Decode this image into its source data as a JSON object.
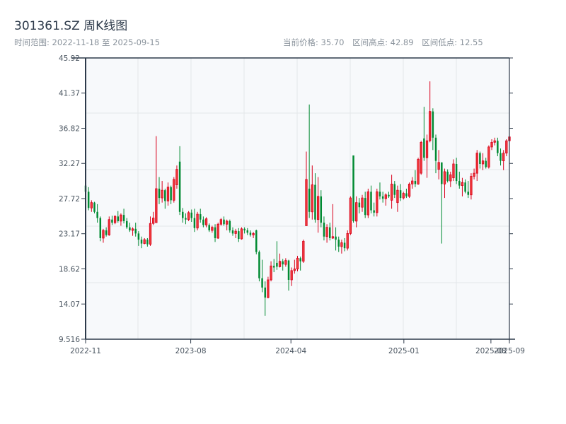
{
  "header": {
    "title": "301361.SZ 周K线图",
    "range_label": "时间范围: 2022-11-18 至 2025-09-15",
    "current_price_label": "当前价格: 35.70",
    "high_label": "区间高点: 42.89",
    "low_label": "区间低点: 12.55"
  },
  "colors": {
    "up": "#d9001b",
    "up_fill": "#f03c3c",
    "down": "#008a32",
    "axis": "#2d3a4a",
    "plot_bg": "#f7f9fb",
    "grid": "#e3e6ea"
  },
  "chart_data": {
    "type": "candlestick",
    "title": "301361.SZ 周K线图",
    "start_date": "2022-11-18",
    "end_date": "2025-09-15",
    "ylim": [
      9.516,
      45.92
    ],
    "y_ticks": [
      "45.92",
      "41.37",
      "36.82",
      "32.27",
      "27.72",
      "23.17",
      "18.62",
      "14.07",
      "9.516"
    ],
    "x_ticks": [
      {
        "label": "2022-11",
        "date": "2022-11-18"
      },
      {
        "label": "2023-08",
        "date": "2023-08-01"
      },
      {
        "label": "2024-04",
        "date": "2024-04-01"
      },
      {
        "label": "2025-01",
        "date": "2025-01-01"
      },
      {
        "label": "2025-08",
        "date": "2025-08-01"
      },
      {
        "label": "2025-09",
        "date": "2025-09-15"
      }
    ],
    "grid": true,
    "ohlc": [
      [
        29.4,
        29.8,
        28.5,
        28.6
      ],
      [
        28.6,
        29.2,
        26.2,
        26.5
      ],
      [
        26.5,
        27.5,
        26.0,
        27.2
      ],
      [
        27.2,
        27.3,
        25.8,
        26.0
      ],
      [
        26.0,
        27.0,
        24.6,
        25.2
      ],
      [
        25.2,
        25.4,
        22.2,
        22.6
      ],
      [
        22.6,
        23.8,
        22.0,
        23.6
      ],
      [
        23.6,
        24.0,
        22.8,
        23.0
      ],
      [
        23.0,
        25.4,
        22.9,
        25.0
      ],
      [
        25.0,
        25.5,
        24.3,
        24.6
      ],
      [
        24.6,
        25.6,
        24.4,
        25.4
      ],
      [
        25.4,
        26.1,
        24.6,
        24.8
      ],
      [
        24.8,
        25.8,
        24.2,
        25.6
      ],
      [
        25.6,
        26.4,
        24.5,
        24.8
      ],
      [
        24.8,
        25.2,
        23.8,
        24.0
      ],
      [
        24.0,
        24.6,
        23.4,
        23.6
      ],
      [
        23.6,
        24.0,
        22.9,
        23.8
      ],
      [
        23.8,
        24.6,
        22.8,
        23.2
      ],
      [
        23.2,
        23.5,
        21.6,
        22.4
      ],
      [
        22.4,
        22.8,
        21.3,
        21.9
      ],
      [
        21.9,
        22.6,
        21.8,
        22.4
      ],
      [
        22.4,
        22.6,
        21.5,
        21.8
      ],
      [
        21.8,
        25.4,
        21.6,
        24.5
      ],
      [
        24.5,
        26.0,
        24.3,
        25.2
      ],
      [
        24.6,
        35.8,
        24.6,
        29.0
      ],
      [
        29.0,
        30.5,
        27.0,
        27.8
      ],
      [
        27.8,
        30.0,
        27.2,
        28.8
      ],
      [
        28.8,
        29.0,
        26.4,
        27.4
      ],
      [
        27.4,
        29.8,
        26.8,
        29.2
      ],
      [
        29.2,
        29.4,
        27.0,
        27.5
      ],
      [
        27.5,
        30.5,
        27.2,
        30.2
      ],
      [
        29.5,
        32.0,
        29.0,
        31.5
      ],
      [
        32.5,
        34.5,
        25.6,
        26.0
      ],
      [
        26.0,
        26.5,
        24.6,
        25.2
      ],
      [
        25.2,
        25.8,
        24.4,
        25.0
      ],
      [
        25.0,
        26.1,
        24.8,
        25.9
      ],
      [
        25.9,
        26.3,
        24.7,
        25.2
      ],
      [
        25.2,
        26.4,
        23.4,
        23.9
      ],
      [
        23.9,
        26.0,
        23.6,
        25.7
      ],
      [
        25.7,
        26.4,
        24.6,
        25.0
      ],
      [
        25.0,
        25.4,
        24.0,
        24.3
      ],
      [
        24.3,
        25.3,
        24.0,
        25.1
      ],
      [
        24.3,
        24.5,
        23.4,
        23.6
      ],
      [
        23.6,
        24.2,
        23.3,
        24.0
      ],
      [
        24.0,
        24.4,
        22.1,
        22.6
      ],
      [
        22.6,
        24.6,
        22.5,
        24.4
      ],
      [
        24.4,
        25.2,
        24.2,
        25.0
      ],
      [
        25.0,
        25.4,
        24.2,
        24.4
      ],
      [
        24.4,
        25.0,
        23.6,
        24.8
      ],
      [
        24.8,
        25.0,
        23.3,
        23.6
      ],
      [
        23.6,
        24.0,
        22.9,
        23.2
      ],
      [
        23.2,
        23.8,
        22.6,
        23.5
      ],
      [
        23.5,
        23.9,
        22.1,
        22.5
      ],
      [
        22.5,
        24.0,
        22.4,
        23.8
      ],
      [
        23.8,
        24.0,
        23.2,
        23.6
      ],
      [
        23.6,
        23.9,
        23.0,
        23.3
      ],
      [
        23.3,
        23.6,
        22.8,
        23.0
      ],
      [
        23.0,
        23.4,
        22.6,
        23.2
      ],
      [
        23.6,
        23.7,
        20.5,
        20.8
      ],
      [
        20.8,
        21.0,
        17.0,
        17.4
      ],
      [
        17.4,
        19.8,
        15.6,
        16.2
      ],
      [
        16.2,
        17.0,
        12.55,
        14.9
      ],
      [
        14.9,
        17.6,
        14.8,
        17.2
      ],
      [
        17.2,
        19.6,
        17.0,
        19.0
      ],
      [
        19.0,
        19.9,
        18.2,
        18.8
      ],
      [
        19.4,
        22.2,
        18.5,
        18.9
      ],
      [
        18.9,
        20.6,
        18.8,
        19.6
      ],
      [
        19.6,
        19.9,
        18.4,
        19.2
      ],
      [
        19.2,
        20.0,
        18.9,
        19.7
      ],
      [
        19.7,
        19.8,
        15.8,
        17.2
      ],
      [
        17.2,
        18.8,
        16.4,
        18.4
      ],
      [
        18.4,
        19.8,
        18.0,
        18.6
      ],
      [
        18.6,
        20.3,
        18.3,
        20.0
      ],
      [
        20.0,
        20.2,
        18.4,
        19.6
      ],
      [
        19.6,
        22.4,
        19.4,
        22.2
      ],
      [
        24.2,
        33.8,
        24.2,
        30.2
      ],
      [
        29.0,
        39.9,
        25.2,
        26.0
      ],
      [
        26.0,
        32.0,
        25.0,
        29.5
      ],
      [
        29.5,
        31.0,
        24.6,
        25.0
      ],
      [
        25.0,
        30.5,
        23.3,
        28.0
      ],
      [
        28.0,
        28.8,
        24.0,
        24.6
      ],
      [
        24.6,
        25.4,
        22.3,
        22.8
      ],
      [
        22.8,
        24.4,
        22.0,
        24.0
      ],
      [
        24.0,
        24.6,
        22.3,
        22.6
      ],
      [
        22.6,
        27.0,
        22.5,
        22.8
      ],
      [
        22.8,
        24.0,
        21.0,
        22.4
      ],
      [
        22.4,
        22.8,
        20.8,
        21.5
      ],
      [
        21.5,
        22.4,
        20.6,
        22.0
      ],
      [
        22.0,
        22.6,
        20.9,
        21.3
      ],
      [
        21.3,
        23.6,
        21.0,
        23.2
      ],
      [
        23.2,
        28.0,
        23.0,
        27.8
      ],
      [
        33.3,
        33.3,
        24.6,
        24.8
      ],
      [
        24.8,
        28.0,
        24.0,
        27.2
      ],
      [
        27.2,
        27.8,
        25.8,
        26.6
      ],
      [
        26.6,
        28.2,
        26.0,
        27.8
      ],
      [
        27.8,
        28.6,
        25.2,
        25.6
      ],
      [
        25.6,
        29.0,
        25.2,
        28.6
      ],
      [
        28.6,
        29.4,
        25.8,
        26.2
      ],
      [
        26.2,
        27.2,
        25.4,
        25.9
      ],
      [
        25.9,
        29.0,
        25.4,
        28.6
      ],
      [
        28.6,
        29.8,
        27.6,
        28.0
      ],
      [
        28.0,
        28.6,
        27.2,
        27.7
      ],
      [
        27.7,
        28.4,
        26.8,
        28.2
      ],
      [
        28.2,
        28.6,
        27.8,
        28.0
      ],
      [
        27.5,
        30.8,
        26.4,
        29.6
      ],
      [
        29.6,
        30.0,
        27.8,
        28.2
      ],
      [
        27.2,
        29.4,
        26.0,
        28.8
      ],
      [
        28.8,
        29.6,
        27.4,
        27.8
      ],
      [
        27.8,
        28.6,
        27.6,
        28.4
      ],
      [
        28.4,
        29.0,
        27.8,
        28.0
      ],
      [
        28.0,
        29.8,
        27.8,
        29.6
      ],
      [
        29.6,
        30.5,
        29.0,
        30.0
      ],
      [
        30.0,
        31.4,
        29.2,
        29.6
      ],
      [
        29.6,
        33.0,
        29.5,
        32.8
      ],
      [
        31.0,
        35.2,
        30.8,
        35.0
      ],
      [
        35.5,
        39.6,
        32.6,
        33.0
      ],
      [
        33.0,
        36.0,
        30.4,
        35.2
      ],
      [
        35.2,
        42.89,
        35.0,
        39.0
      ],
      [
        39.0,
        39.4,
        34.0,
        35.6
      ],
      [
        35.6,
        36.0,
        31.0,
        32.6
      ],
      [
        31.5,
        34.0,
        30.2,
        32.4
      ],
      [
        32.4,
        32.4,
        21.9,
        29.6
      ],
      [
        29.6,
        31.6,
        27.8,
        31.2
      ],
      [
        31.2,
        31.5,
        29.8,
        30.0
      ],
      [
        30.0,
        31.2,
        29.2,
        30.8
      ],
      [
        30.4,
        32.8,
        30.0,
        32.2
      ],
      [
        32.2,
        33.0,
        29.6,
        30.0
      ],
      [
        30.0,
        31.2,
        29.0,
        29.4
      ],
      [
        29.4,
        30.4,
        28.0,
        29.8
      ],
      [
        29.8,
        30.2,
        28.4,
        28.6
      ],
      [
        28.6,
        30.0,
        27.8,
        28.2
      ],
      [
        28.2,
        31.0,
        27.6,
        30.6
      ],
      [
        30.6,
        31.6,
        30.2,
        31.0
      ],
      [
        31.0,
        34.0,
        30.0,
        33.6
      ],
      [
        33.6,
        33.8,
        31.6,
        32.2
      ],
      [
        32.2,
        33.6,
        31.4,
        32.6
      ],
      [
        32.6,
        33.0,
        31.6,
        31.8
      ],
      [
        31.8,
        34.6,
        31.6,
        34.4
      ],
      [
        34.4,
        35.4,
        34.0,
        35.0
      ],
      [
        35.0,
        35.6,
        34.6,
        35.2
      ],
      [
        35.2,
        35.6,
        33.2,
        33.6
      ],
      [
        33.6,
        34.2,
        32.0,
        32.6
      ],
      [
        32.6,
        34.0,
        31.4,
        33.6
      ],
      [
        33.6,
        35.4,
        33.2,
        35.2
      ],
      [
        35.2,
        36.2,
        34.4,
        35.7
      ]
    ]
  }
}
